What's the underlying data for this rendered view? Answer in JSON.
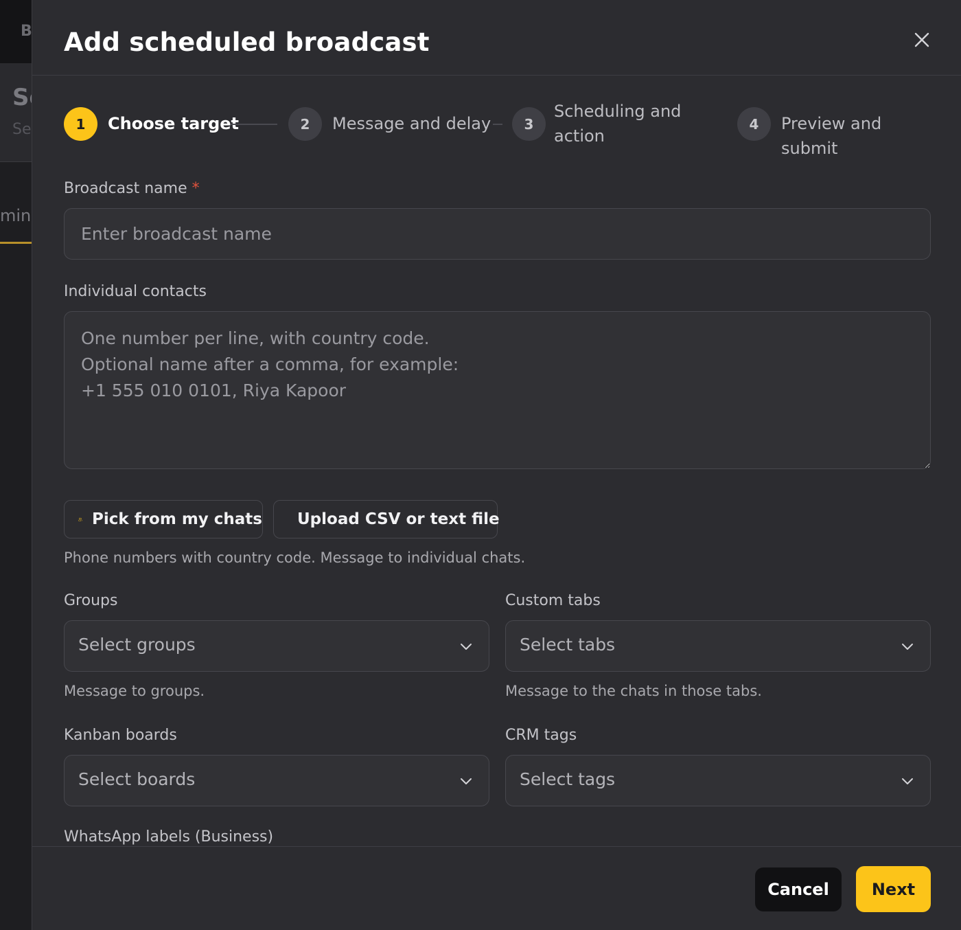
{
  "background": {
    "top_letter": "B",
    "header_title": "Se",
    "header_sub": "Se",
    "tab": "min"
  },
  "modal": {
    "title": "Add scheduled broadcast",
    "close_icon": "close-icon"
  },
  "steps": [
    {
      "number": "1",
      "label": "Choose target",
      "active": true
    },
    {
      "number": "2",
      "label": "Message and delay",
      "active": false
    },
    {
      "number": "3",
      "label_line1": "Scheduling and",
      "label_line2": "action",
      "active": false
    },
    {
      "number": "4",
      "label": "Preview and submit",
      "active": false
    }
  ],
  "broadcast_name": {
    "label": "Broadcast name",
    "required_mark": "*",
    "placeholder": "Enter broadcast name",
    "value": ""
  },
  "individual_contacts": {
    "label": "Individual contacts",
    "placeholder": "One number per line, with country code.\nOptional name after a comma, for example:\n+1 555 010 0101, Riya Kapoor"
  },
  "actions": {
    "pick_chats": {
      "label": "Pick from my chats",
      "icon": "users-icon"
    },
    "upload_csv": {
      "label": "Upload CSV or text file",
      "icon": "file-upload-icon"
    },
    "help": "Phone numbers with country code. Message to individual chats."
  },
  "groups": {
    "label": "Groups",
    "placeholder": "Select groups",
    "help": "Message to groups."
  },
  "custom_tabs": {
    "label": "Custom tabs",
    "placeholder": "Select tabs",
    "help": "Message to the chats in those tabs."
  },
  "kanban": {
    "label": "Kanban boards",
    "placeholder": "Select boards"
  },
  "crm_tags": {
    "label": "CRM tags",
    "placeholder": "Select tags"
  },
  "whatsapp_labels": {
    "label": "WhatsApp labels (Business)"
  },
  "footer": {
    "cancel": "Cancel",
    "next": "Next"
  },
  "colors": {
    "accent": "#fcc419",
    "modal_bg": "#2c2c30",
    "required": "#e0533d"
  }
}
